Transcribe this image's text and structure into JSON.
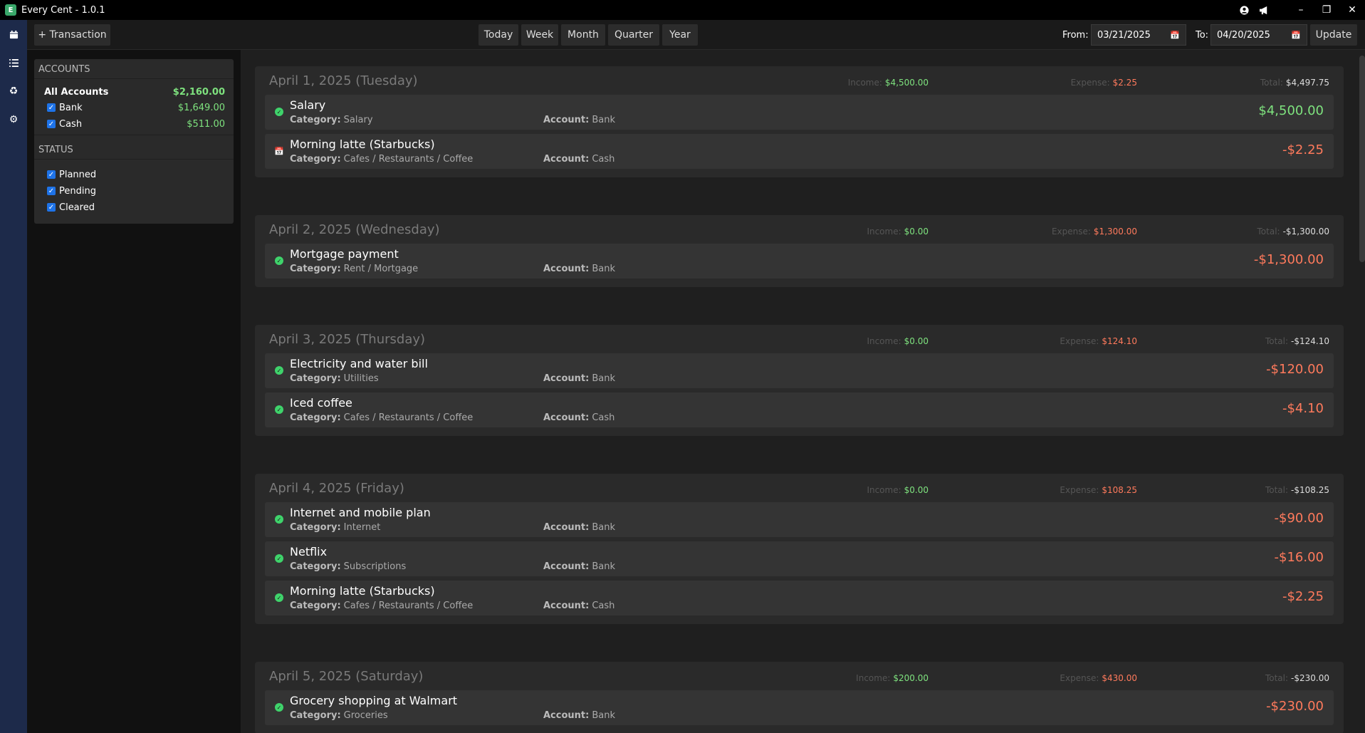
{
  "app": {
    "title": "Every Cent - 1.0.1",
    "logo": "E"
  },
  "titlebar": {
    "icons": [
      "user-icon",
      "megaphone-icon"
    ]
  },
  "rail": {
    "icons": [
      "calendar-icon",
      "list-icon",
      "recycle-icon",
      "gear-icon"
    ]
  },
  "toolbar": {
    "add_label": "+ Transaction",
    "periods": [
      "Today",
      "Week",
      "Month",
      "Quarter",
      "Year"
    ],
    "from_label": "From:",
    "from_value": "03/21/2025",
    "to_label": "To:",
    "to_value": "04/20/2025",
    "update_label": "Update"
  },
  "filters": {
    "accounts_heading": "ACCOUNTS",
    "all_accounts": {
      "label": "All Accounts",
      "amount": "$2,160.00"
    },
    "accounts": [
      {
        "label": "Bank",
        "amount": "$1,649.00",
        "checked": true
      },
      {
        "label": "Cash",
        "amount": "$511.00",
        "checked": true
      }
    ],
    "status_heading": "STATUS",
    "statuses": [
      {
        "label": "Planned",
        "checked": true
      },
      {
        "label": "Pending",
        "checked": true
      },
      {
        "label": "Cleared",
        "checked": true
      }
    ]
  },
  "labels": {
    "income": "Income:",
    "expense": "Expense:",
    "total": "Total:",
    "category": "Category:",
    "account": "Account:"
  },
  "colors": {
    "income": "#7ee27e",
    "expense": "#ff7a5c",
    "total": "#dddddd",
    "cleared": "#3fd36b",
    "planned": "#4aa3ff"
  },
  "days": [
    {
      "title": "April 1, 2025 (Tuesday)",
      "income": "$4,500.00",
      "expense": "$2.25",
      "total": "$4,497.75",
      "transactions": [
        {
          "status": "cleared",
          "name": "Salary",
          "category": "Salary",
          "account": "Bank",
          "amount": "$4,500.00",
          "type": "income"
        },
        {
          "status": "planned",
          "name": "Morning latte (Starbucks)",
          "category": "Cafes / Restaurants / Coffee",
          "account": "Cash",
          "amount": "-$2.25",
          "type": "expense"
        }
      ]
    },
    {
      "title": "April 2, 2025 (Wednesday)",
      "income": "$0.00",
      "expense": "$1,300.00",
      "total": "-$1,300.00",
      "transactions": [
        {
          "status": "cleared",
          "name": "Mortgage payment",
          "category": "Rent / Mortgage",
          "account": "Bank",
          "amount": "-$1,300.00",
          "type": "expense"
        }
      ]
    },
    {
      "title": "April 3, 2025 (Thursday)",
      "income": "$0.00",
      "expense": "$124.10",
      "total": "-$124.10",
      "transactions": [
        {
          "status": "cleared",
          "name": "Electricity and water bill",
          "category": "Utilities",
          "account": "Bank",
          "amount": "-$120.00",
          "type": "expense"
        },
        {
          "status": "cleared",
          "name": "Iced coffee",
          "category": "Cafes / Restaurants / Coffee",
          "account": "Cash",
          "amount": "-$4.10",
          "type": "expense"
        }
      ]
    },
    {
      "title": "April 4, 2025 (Friday)",
      "income": "$0.00",
      "expense": "$108.25",
      "total": "-$108.25",
      "transactions": [
        {
          "status": "cleared",
          "name": "Internet and mobile plan",
          "category": "Internet",
          "account": "Bank",
          "amount": "-$90.00",
          "type": "expense"
        },
        {
          "status": "cleared",
          "name": "Netflix",
          "category": "Subscriptions",
          "account": "Bank",
          "amount": "-$16.00",
          "type": "expense"
        },
        {
          "status": "cleared",
          "name": "Morning latte (Starbucks)",
          "category": "Cafes / Restaurants / Coffee",
          "account": "Cash",
          "amount": "-$2.25",
          "type": "expense"
        }
      ]
    },
    {
      "title": "April 5, 2025 (Saturday)",
      "income": "$200.00",
      "expense": "$430.00",
      "total": "-$230.00",
      "transactions": [
        {
          "status": "cleared",
          "name": "Grocery shopping at Walmart",
          "category": "Groceries",
          "account": "Bank",
          "amount": "-$230.00",
          "type": "expense"
        }
      ]
    }
  ]
}
